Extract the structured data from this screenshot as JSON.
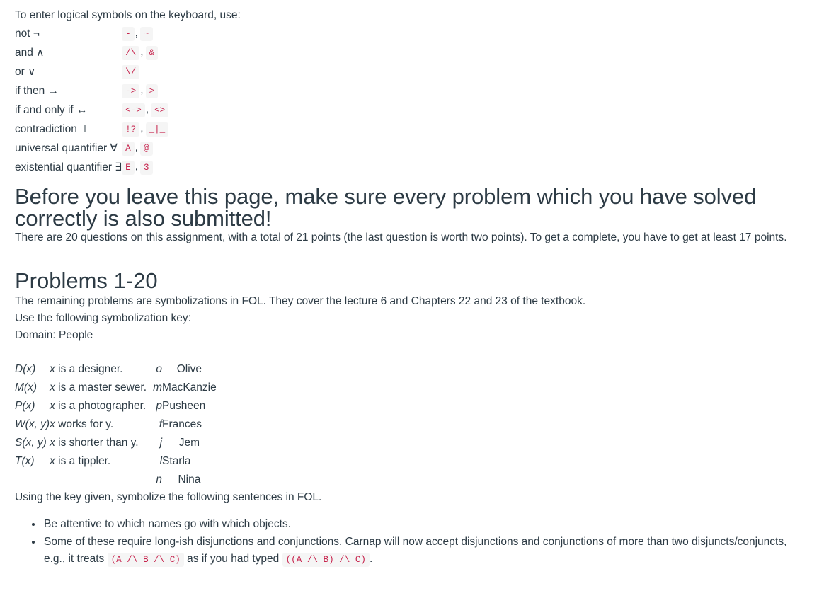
{
  "intro": {
    "line": "To enter logical symbols on the keyboard, use:"
  },
  "symbol_table": {
    "rows": [
      {
        "label": "not ¬",
        "codes": [
          "-",
          "~"
        ]
      },
      {
        "label": "and ∧",
        "codes": [
          "/\\",
          "&"
        ]
      },
      {
        "label": "or ∨",
        "codes": [
          "\\/"
        ]
      },
      {
        "label": "if then →",
        "codes": [
          "->",
          ">"
        ]
      },
      {
        "label": "if and only if ↔",
        "codes": [
          "<->",
          "<>"
        ]
      },
      {
        "label": "contradiction ⊥",
        "codes": [
          "!?",
          "_|_"
        ]
      },
      {
        "label": "universal quantifier ∀",
        "codes": [
          "A",
          "@"
        ]
      },
      {
        "label": "existential quantifier ∃",
        "codes": [
          "E",
          "3"
        ]
      }
    ],
    "separator": ","
  },
  "alert": {
    "heading": "Before you leave this page, make sure every problem which you have solved correctly is also submitted!",
    "paragraph": "There are 20 questions on this assignment, with a total of 21 points (the last question is worth two points). To get a complete, you have to get at least 17 points."
  },
  "problems": {
    "heading": "Problems 1-20",
    "intro": "The remaining problems are symbolizations in FOL. They cover the lecture 6 and Chapters 22 and 23 of the textbook.",
    "use_key": "Use the following symbolization key:",
    "domain": "Domain: People"
  },
  "key_table": {
    "rows": [
      {
        "predicate": "D(x)",
        "gloss_var": "x",
        "gloss_rest": " is a designer.",
        "constant": "o",
        "name": "Olive"
      },
      {
        "predicate": "M(x)",
        "gloss_var": "x",
        "gloss_rest": " is a master sewer.",
        "constant": "m",
        "name": "MacKanzie"
      },
      {
        "predicate": "P(x)",
        "gloss_var": "x",
        "gloss_rest": " is a photographer.",
        "constant": "p",
        "name": "Pusheen"
      },
      {
        "predicate": "W(x, y)",
        "gloss_var": "x",
        "gloss_rest": " works for y.",
        "constant": "f",
        "name": "Frances"
      },
      {
        "predicate": "S(x, y)",
        "gloss_var": "x",
        "gloss_rest": " is shorter than y.",
        "constant": "j",
        "name": "Jem"
      },
      {
        "predicate": "T(x)",
        "gloss_var": "x",
        "gloss_rest": " is a tippler.",
        "constant": "l",
        "name": "Starla"
      },
      {
        "predicate": "",
        "gloss_var": "",
        "gloss_rest": "",
        "constant": "n",
        "name": "Nina"
      }
    ]
  },
  "instruction": "Using the key given, symbolize the following sentences in FOL.",
  "notes": {
    "bullet1": "Be attentive to which names go with which objects.",
    "bullet2_part1": "Some of these require long-ish disjunctions and conjunctions. Carnap will now accept disjunctions and conjunctions of more than two disjuncts/conjuncts, e.g., it treats",
    "bullet2_code1": "(A /\\ B /\\ C)",
    "bullet2_part2": "as if you had typed",
    "bullet2_code2": "((A /\\ B) /\\ C)",
    "bullet2_part3": "."
  },
  "colors": {
    "text": "#2d3b45",
    "code_text": "#c7254e",
    "code_bg": "#f5f5f5"
  }
}
